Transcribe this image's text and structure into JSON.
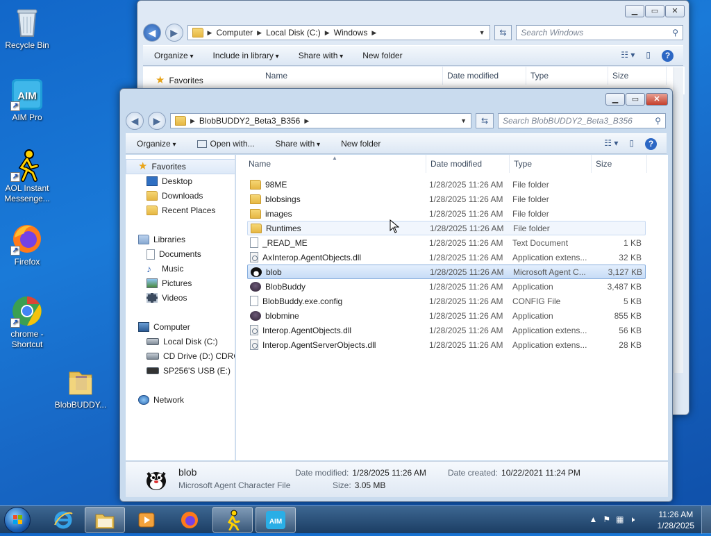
{
  "desktop": {
    "icons": [
      {
        "label": "Recycle Bin",
        "icon": "recycle-bin-icon"
      },
      {
        "label": "AIM Pro",
        "icon": "aim-icon"
      },
      {
        "label": "AOL Instant Messenge...",
        "icon": "aol-running-man-icon"
      },
      {
        "label": "Firefox",
        "icon": "firefox-icon"
      },
      {
        "label": "chrome - Shortcut",
        "icon": "chrome-icon"
      },
      {
        "label": "BlobBUDDY...",
        "icon": "folder-icon"
      }
    ]
  },
  "back_window": {
    "address": [
      "Computer",
      "Local Disk (C:)",
      "Windows"
    ],
    "search_placeholder": "Search Windows",
    "toolbar": {
      "organize": "Organize",
      "include": "Include in library",
      "share": "Share with",
      "new_folder": "New folder"
    },
    "favorites": "Favorites",
    "columns": {
      "name": "Name",
      "date": "Date modified",
      "type": "Type",
      "size": "Size"
    }
  },
  "front_window": {
    "address": [
      "BlobBUDDY2_Beta3_B356"
    ],
    "search_placeholder": "Search BlobBUDDY2_Beta3_B356",
    "toolbar": {
      "organize": "Organize",
      "open_with": "Open with...",
      "share": "Share with",
      "new_folder": "New folder"
    },
    "nav": {
      "favorites": "Favorites",
      "desktop": "Desktop",
      "downloads": "Downloads",
      "recent": "Recent Places",
      "libraries": "Libraries",
      "documents": "Documents",
      "music": "Music",
      "pictures": "Pictures",
      "videos": "Videos",
      "computer": "Computer",
      "local_disk": "Local Disk (C:)",
      "cd_drive": "CD Drive (D:) CDROM",
      "usb": "SP256'S USB (E:)",
      "network": "Network"
    },
    "columns": {
      "name": "Name",
      "date": "Date modified",
      "type": "Type",
      "size": "Size"
    },
    "files": [
      {
        "name": "98ME",
        "date": "1/28/2025 11:26 AM",
        "type": "File folder",
        "size": "",
        "icon": "folder"
      },
      {
        "name": "blobsings",
        "date": "1/28/2025 11:26 AM",
        "type": "File folder",
        "size": "",
        "icon": "folder"
      },
      {
        "name": "images",
        "date": "1/28/2025 11:26 AM",
        "type": "File folder",
        "size": "",
        "icon": "folder"
      },
      {
        "name": "Runtimes",
        "date": "1/28/2025 11:26 AM",
        "type": "File folder",
        "size": "",
        "icon": "folder"
      },
      {
        "name": "_READ_ME",
        "date": "1/28/2025 11:26 AM",
        "type": "Text Document",
        "size": "1 KB",
        "icon": "doc"
      },
      {
        "name": "AxInterop.AgentObjects.dll",
        "date": "1/28/2025 11:26 AM",
        "type": "Application extens...",
        "size": "32 KB",
        "icon": "dll"
      },
      {
        "name": "blob",
        "date": "1/28/2025 11:26 AM",
        "type": "Microsoft Agent C...",
        "size": "3,127 KB",
        "icon": "agent"
      },
      {
        "name": "BlobBuddy",
        "date": "1/28/2025 11:26 AM",
        "type": "Application",
        "size": "3,487 KB",
        "icon": "app"
      },
      {
        "name": "BlobBuddy.exe.config",
        "date": "1/28/2025 11:26 AM",
        "type": "CONFIG File",
        "size": "5 KB",
        "icon": "doc"
      },
      {
        "name": "blobmine",
        "date": "1/28/2025 11:26 AM",
        "type": "Application",
        "size": "855 KB",
        "icon": "app"
      },
      {
        "name": "Interop.AgentObjects.dll",
        "date": "1/28/2025 11:26 AM",
        "type": "Application extens...",
        "size": "56 KB",
        "icon": "dll"
      },
      {
        "name": "Interop.AgentServerObjects.dll",
        "date": "1/28/2025 11:26 AM",
        "type": "Application extens...",
        "size": "28 KB",
        "icon": "dll"
      }
    ],
    "details": {
      "name": "blob",
      "kind": "Microsoft Agent Character File",
      "modified_label": "Date modified:",
      "modified": "1/28/2025 11:26 AM",
      "size_label": "Size:",
      "size": "3.05 MB",
      "created_label": "Date created:",
      "created": "10/22/2021 11:24 PM"
    }
  },
  "taskbar": {
    "time": "11:26 AM",
    "date": "1/28/2025"
  }
}
